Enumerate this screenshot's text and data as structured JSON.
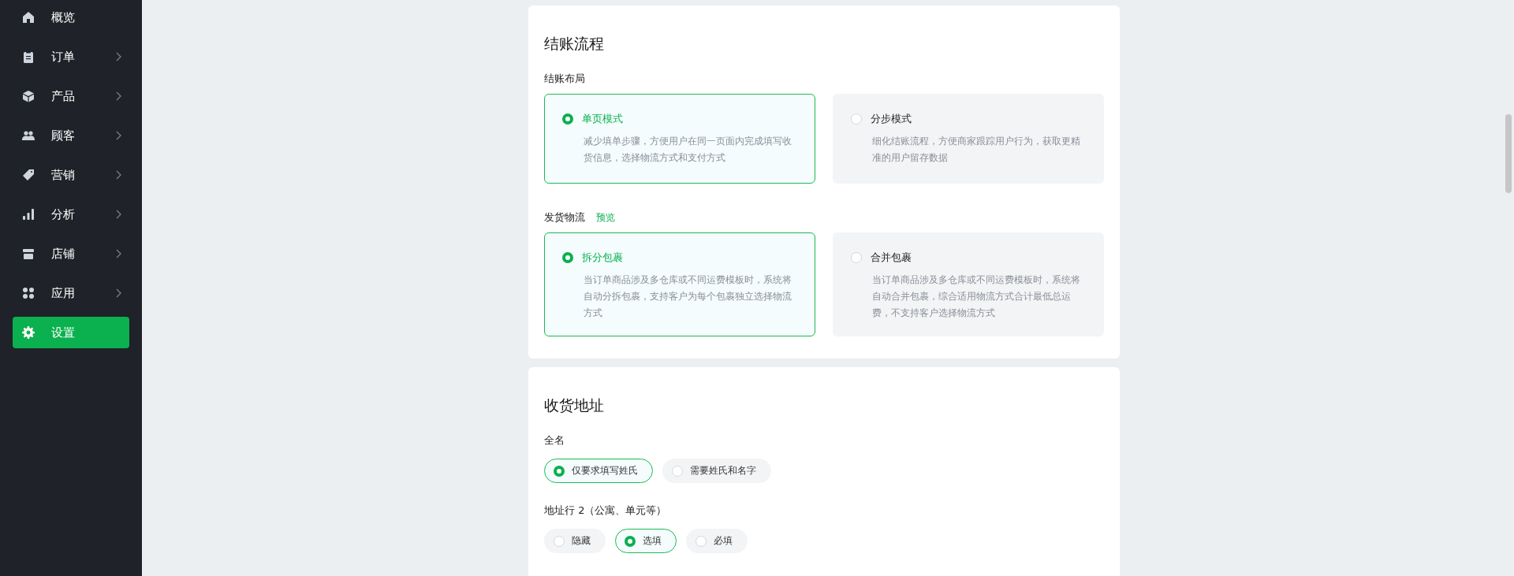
{
  "sidebar": {
    "items": [
      {
        "label": "概览",
        "has_children": false,
        "selected": false
      },
      {
        "label": "订单",
        "has_children": true,
        "selected": false
      },
      {
        "label": "产品",
        "has_children": true,
        "selected": false
      },
      {
        "label": "顾客",
        "has_children": true,
        "selected": false
      },
      {
        "label": "营销",
        "has_children": true,
        "selected": false
      },
      {
        "label": "分析",
        "has_children": true,
        "selected": false
      },
      {
        "label": "店铺",
        "has_children": true,
        "selected": false
      },
      {
        "label": "应用",
        "has_children": true,
        "selected": false
      },
      {
        "label": "设置",
        "has_children": false,
        "selected": true
      }
    ]
  },
  "checkout": {
    "title": "结账流程",
    "layout": {
      "label": "结账布局",
      "options": [
        {
          "title": "单页模式",
          "description": "减少填单步骤，方便用户在同一页面内完成填写收货信息，选择物流方式和支付方式",
          "selected": true
        },
        {
          "title": "分步模式",
          "description": "细化结账流程，方便商家跟踪用户行为，获取更精准的用户留存数据",
          "selected": false
        }
      ]
    },
    "shipping": {
      "label": "发货物流",
      "link": "预览",
      "options": [
        {
          "title": "拆分包裹",
          "description": "当订单商品涉及多仓库或不同运费模板时，系统将自动分拆包裹，支持客户为每个包裹独立选择物流方式",
          "selected": true
        },
        {
          "title": "合并包裹",
          "description": "当订单商品涉及多仓库或不同运费模板时，系统将自动合并包裹，综合适用物流方式合计最低总运费，不支持客户选择物流方式",
          "selected": false
        }
      ]
    }
  },
  "address": {
    "title": "收货地址",
    "fields": [
      {
        "label": "全名",
        "options": [
          {
            "label": "仅要求填写姓氏",
            "selected": true
          },
          {
            "label": "需要姓氏和名字",
            "selected": false
          }
        ]
      },
      {
        "label": "地址行 2（公寓、单元等）",
        "options": [
          {
            "label": "隐藏",
            "selected": false
          },
          {
            "label": "选填",
            "selected": true
          },
          {
            "label": "必填",
            "selected": false
          }
        ]
      }
    ]
  }
}
